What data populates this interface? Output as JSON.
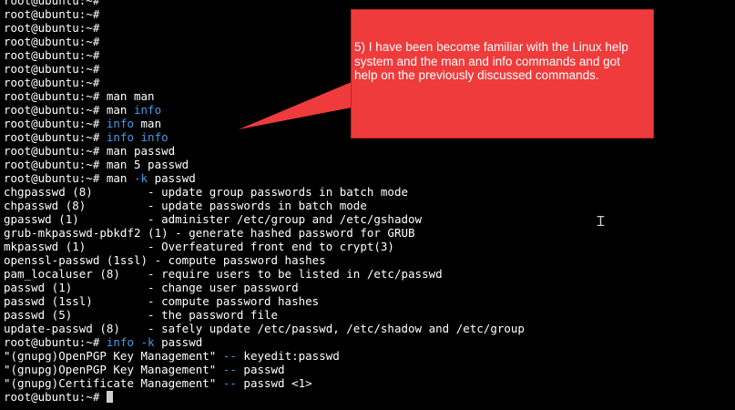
{
  "terminal": {
    "lines": [
      [
        {
          "t": "root@ubuntu:~#"
        }
      ],
      [
        {
          "t": "root@ubuntu:~#"
        }
      ],
      [
        {
          "t": "root@ubuntu:~#"
        }
      ],
      [
        {
          "t": "root@ubuntu:~#"
        }
      ],
      [
        {
          "t": "root@ubuntu:~#"
        }
      ],
      [
        {
          "t": "root@ubuntu:~#"
        }
      ],
      [
        {
          "t": "root@ubuntu:~#"
        }
      ],
      [
        {
          "t": "root@ubuntu:~# man man"
        }
      ],
      [
        {
          "t": "root@ubuntu:~# man "
        },
        {
          "t": "info",
          "hl": true
        }
      ],
      [
        {
          "t": "root@ubuntu:~# "
        },
        {
          "t": "info",
          "hl": true
        },
        {
          "t": " man"
        }
      ],
      [
        {
          "t": "root@ubuntu:~# "
        },
        {
          "t": "info info",
          "hl": true
        }
      ],
      [
        {
          "t": "root@ubuntu:~# man passwd"
        }
      ],
      [
        {
          "t": "root@ubuntu:~# man 5 passwd"
        }
      ],
      [
        {
          "t": "root@ubuntu:~# man "
        },
        {
          "t": "-k",
          "hl": true
        },
        {
          "t": " passwd"
        }
      ],
      [
        {
          "t": "chgpasswd (8)        - update group passwords in batch mode"
        }
      ],
      [
        {
          "t": "chpasswd (8)         - update passwords in batch mode"
        }
      ],
      [
        {
          "t": "gpasswd (1)          - administer /etc/group and /etc/gshadow"
        }
      ],
      [
        {
          "t": "grub-mkpasswd-pbkdf2 (1) - generate hashed password for GRUB"
        }
      ],
      [
        {
          "t": "mkpasswd (1)         - Overfeatured front end to crypt(3)"
        }
      ],
      [
        {
          "t": "openssl-passwd (1ssl) - compute password hashes"
        }
      ],
      [
        {
          "t": "pam_localuser (8)    - require users to be listed in /etc/passwd"
        }
      ],
      [
        {
          "t": "passwd (1)           - change user password"
        }
      ],
      [
        {
          "t": "passwd (1ssl)        - compute password hashes"
        }
      ],
      [
        {
          "t": "passwd (5)           - the password file"
        }
      ],
      [
        {
          "t": "update-passwd (8)    - safely update /etc/passwd, /etc/shadow and /etc/group"
        }
      ],
      [
        {
          "t": "root@ubuntu:~# "
        },
        {
          "t": "info -k",
          "hl": true
        },
        {
          "t": " passwd"
        }
      ],
      [
        {
          "t": "\"(gnupg)OpenPGP Key Management\" "
        },
        {
          "t": "--",
          "hl": true
        },
        {
          "t": " keyedit:passwd"
        }
      ],
      [
        {
          "t": "\"(gnupg)OpenPGP Key Management\" "
        },
        {
          "t": "--",
          "hl": true
        },
        {
          "t": " passwd"
        }
      ],
      [
        {
          "t": "\"(gnupg)Certificate Management\" "
        },
        {
          "t": "--",
          "hl": true
        },
        {
          "t": " passwd <1>"
        }
      ],
      [
        {
          "t": "root@ubuntu:~# "
        }
      ]
    ]
  },
  "callout": {
    "text": "5) I have been become familiar with the Linux help system and the man and info commands and got help on the previously discussed commands."
  },
  "colors": {
    "background": "#000000",
    "text": "#ffffff",
    "highlight": "#3f9fe6",
    "callout": "#ef3b3b"
  },
  "icons": {
    "pointer": "text-cursor-icon",
    "cursor_block": "terminal-cursor-icon"
  }
}
